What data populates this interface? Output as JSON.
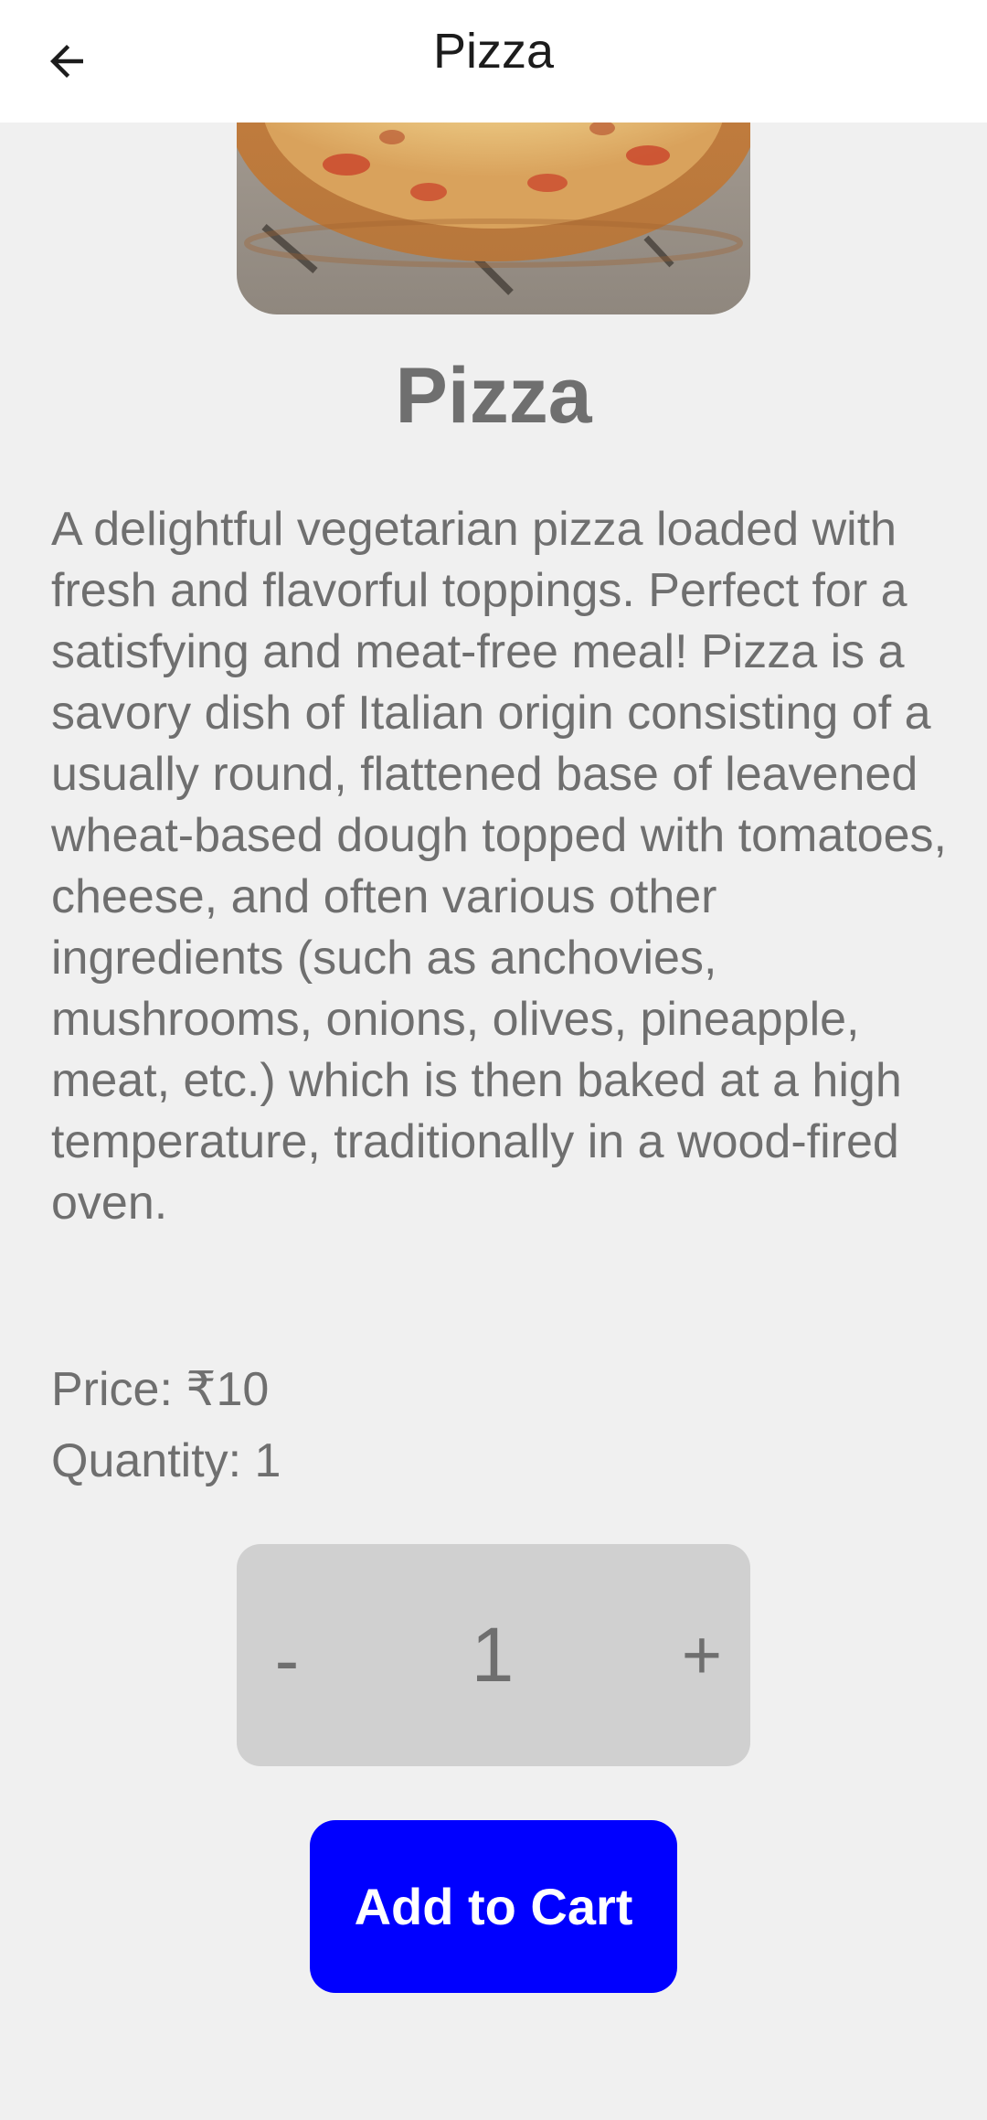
{
  "appbar": {
    "title": "Pizza",
    "back_icon": "arrow-left-icon"
  },
  "product": {
    "image_alt": "pizza-photo",
    "title": "Pizza",
    "description": "A delightful vegetarian pizza loaded with fresh and flavorful toppings. Perfect for a satisfying and meat-free meal! Pizza is a savory dish of Italian origin consisting of a usually round, flattened base of leavened wheat-based dough topped with tomatoes, cheese, and often various other ingredients (such as anchovies, mushrooms, onions, olives, pineapple, meat, etc.) which is then baked at a high temperature, traditionally in a wood-fired oven.",
    "price_text": "Price: ₹10",
    "quantity_text": "Quantity: 1"
  },
  "stepper": {
    "minus_label": "-",
    "value": "1",
    "plus_label": "+"
  },
  "actions": {
    "add_to_cart_label": "Add to Cart"
  },
  "colors": {
    "background": "#f0f0f0",
    "appbar": "#ffffff",
    "text_muted": "#6f6f6f",
    "stepper_bg": "#d0d0d0",
    "primary_button": "#0000ff"
  }
}
